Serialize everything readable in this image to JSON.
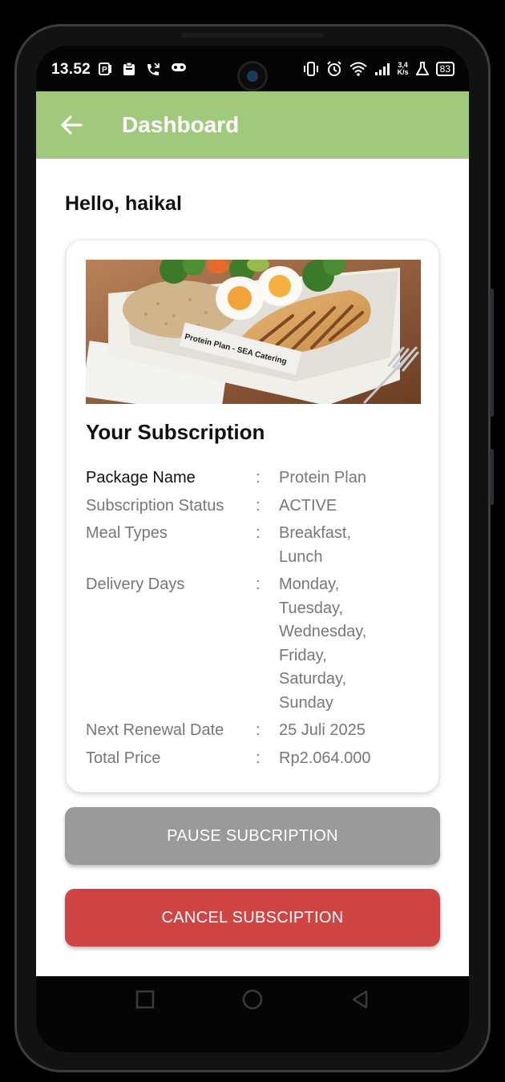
{
  "status_bar": {
    "time": "13.52",
    "network_speed_value": "3,4",
    "network_speed_unit": "K/s",
    "battery": "83",
    "icons_left": [
      "notification-p-icon",
      "clipboard-icon",
      "missed-call-icon",
      "gamepad-icon"
    ],
    "icons_right": [
      "vibrate-icon",
      "alarm-icon",
      "wifi-icon",
      "signal-icon",
      "lab-icon"
    ]
  },
  "app_bar": {
    "title": "Dashboard"
  },
  "greeting": "Hello, haikal",
  "subscription": {
    "image_label": "Protein Plan - SEA Catering",
    "title": "Your Subscription",
    "separator": ":",
    "rows": [
      {
        "label": "Package Name",
        "value": "Protein Plan"
      },
      {
        "label": "Subscription Status",
        "value": "ACTIVE"
      },
      {
        "label": "Meal Types",
        "value": "Breakfast,\nLunch"
      },
      {
        "label": "Delivery Days",
        "value": "Monday,\nTuesday,\nWednesday,\nFriday,\nSaturday,\nSunday"
      },
      {
        "label": "Next Renewal Date",
        "value": "25 Juli 2025"
      },
      {
        "label": "Total Price",
        "value": "Rp2.064.000"
      }
    ]
  },
  "buttons": {
    "pause": "PAUSE SUBCRIPTION",
    "cancel": "CANCEL SUBSCIPTION"
  },
  "colors": {
    "app_bar": "#a1c97c",
    "pause_button": "#9a9a9a",
    "cancel_button": "#cf4444"
  }
}
